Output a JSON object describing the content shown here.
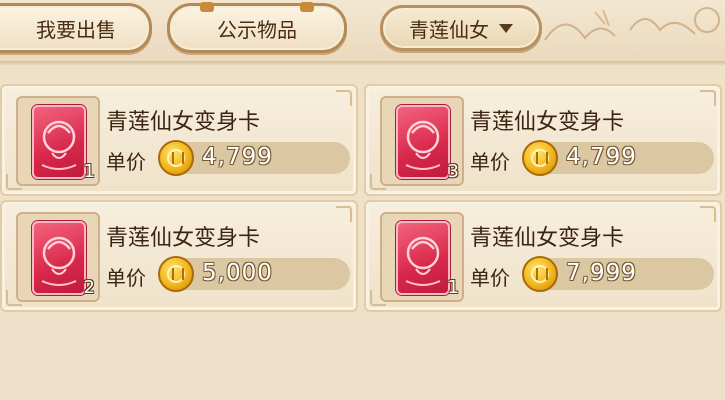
{
  "tabs": {
    "sell_label": "我要出售",
    "public_label": "公示物品",
    "filter_label": "青莲仙女"
  },
  "price_label": "单价",
  "colors": {
    "background": "#efe0c8",
    "card_red": "#d8284a",
    "coin_gold": "#f3b51d",
    "text_brown": "#3b2412"
  },
  "listings": [
    {
      "name": "青莲仙女变身卡",
      "quantity": "1",
      "price": "4,799",
      "icon": "transformation-card-icon"
    },
    {
      "name": "青莲仙女变身卡",
      "quantity": "3",
      "price": "4,799",
      "icon": "transformation-card-icon"
    },
    {
      "name": "青莲仙女变身卡",
      "quantity": "2",
      "price": "5,000",
      "icon": "transformation-card-icon"
    },
    {
      "name": "青莲仙女变身卡",
      "quantity": "1",
      "price": "7,999",
      "icon": "transformation-card-icon"
    }
  ]
}
